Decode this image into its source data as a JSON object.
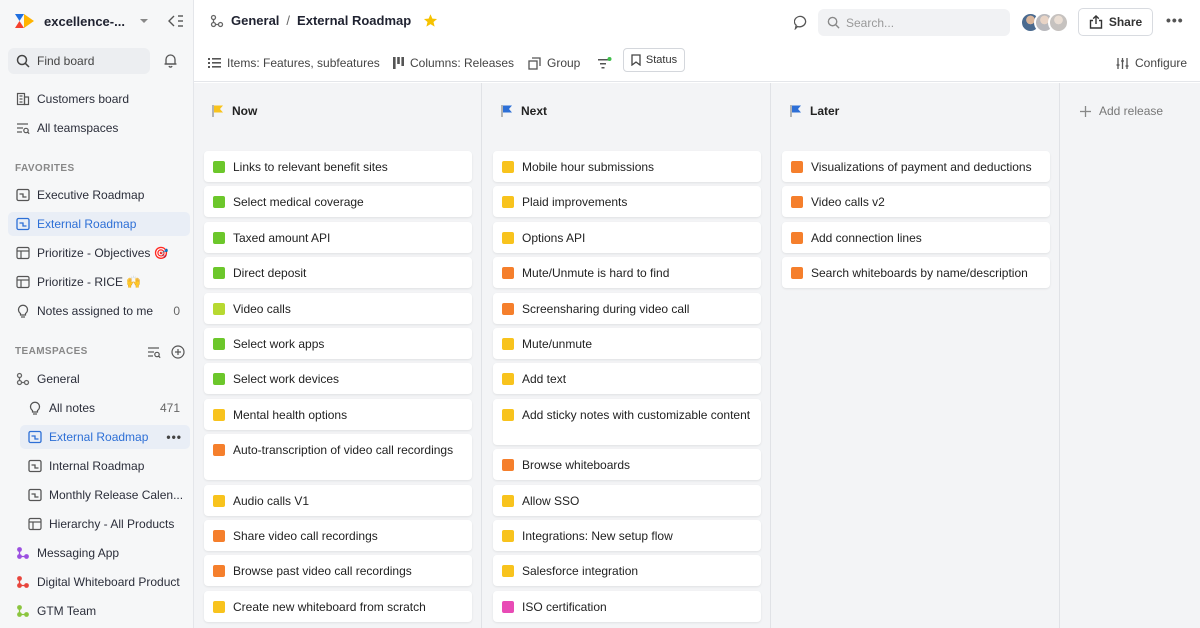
{
  "colors": {
    "green": "#6cc72b",
    "lime": "#b7d931",
    "yellow": "#f8c31d",
    "orange": "#f57f2c",
    "magenta": "#e84bb5",
    "accent": "#2d6fd6"
  },
  "sidebar": {
    "workspace_name": "excellence-...",
    "find_board": "Find board",
    "top_items": [
      {
        "label": "Customers board",
        "icon": "building-icon"
      },
      {
        "label": "All teamspaces",
        "icon": "teamspaces-list-icon"
      }
    ],
    "favorites_label": "FAVORITES",
    "favorites": [
      {
        "label": "Executive Roadmap",
        "icon": "roadmap-icon"
      },
      {
        "label": "External Roadmap",
        "icon": "roadmap-icon",
        "active": true
      },
      {
        "label": "Prioritize - Objectives 🎯",
        "icon": "table-icon"
      },
      {
        "label": "Prioritize - RICE 🙌",
        "icon": "table-icon"
      },
      {
        "label": "Notes assigned to me",
        "icon": "lightbulb-icon",
        "count": "0"
      }
    ],
    "teamspaces_label": "TEAMSPACES",
    "teamspaces": [
      {
        "label": "General",
        "icon": "teamspace-icon",
        "sub": false
      },
      {
        "label": "All notes",
        "icon": "lightbulb-icon",
        "sub": true,
        "count": "471"
      },
      {
        "label": "External Roadmap",
        "icon": "roadmap-icon",
        "sub": true,
        "active": true
      },
      {
        "label": "Internal Roadmap",
        "icon": "roadmap-icon",
        "sub": true
      },
      {
        "label": "Monthly Release Calen...",
        "icon": "roadmap-icon",
        "sub": true
      },
      {
        "label": "Hierarchy - All Products",
        "icon": "table-icon",
        "sub": true
      },
      {
        "label": "Messaging App",
        "icon": "teamspace-purple-icon",
        "sub": false
      },
      {
        "label": "Digital Whiteboard Product",
        "icon": "teamspace-red-icon",
        "sub": false
      },
      {
        "label": "GTM Team",
        "icon": "teamspace-green-icon",
        "sub": false
      }
    ]
  },
  "header": {
    "crumb_parent": "General",
    "crumb_sep": "/",
    "crumb_current": "External Roadmap",
    "search_placeholder": "Search...",
    "share_label": "Share"
  },
  "toolbar": {
    "items_label": "Items: Features, subfeatures",
    "columns_label": "Columns: Releases",
    "group_label": "Group",
    "status_label": "Status",
    "configure_label": "Configure"
  },
  "board": {
    "add_release": "Add release",
    "columns": [
      {
        "title": "Now",
        "flag_color": "#f8c31d",
        "cards": [
          {
            "label": "Links to relevant benefit sites",
            "color": "#6cc72b"
          },
          {
            "label": "Select medical coverage",
            "color": "#6cc72b"
          },
          {
            "label": "Taxed amount API",
            "color": "#6cc72b"
          },
          {
            "label": "Direct deposit",
            "color": "#6cc72b"
          },
          {
            "label": "Video calls",
            "color": "#b7d931"
          },
          {
            "label": "Select work apps",
            "color": "#6cc72b"
          },
          {
            "label": "Select work devices",
            "color": "#6cc72b"
          },
          {
            "label": "Mental health options",
            "color": "#f8c31d"
          },
          {
            "label": "Auto-transcription of video call recordings",
            "color": "#f57f2c",
            "tall": true
          },
          {
            "label": "Audio calls V1",
            "color": "#f8c31d"
          },
          {
            "label": "Share video call recordings",
            "color": "#f57f2c"
          },
          {
            "label": "Browse past video call recordings",
            "color": "#f57f2c"
          },
          {
            "label": "Create new whiteboard from scratch",
            "color": "#f8c31d"
          }
        ]
      },
      {
        "title": "Next",
        "flag_color": "#2d6fd6",
        "cards": [
          {
            "label": "Mobile hour submissions",
            "color": "#f8c31d"
          },
          {
            "label": "Plaid improvements",
            "color": "#f8c31d"
          },
          {
            "label": "Options API",
            "color": "#f8c31d"
          },
          {
            "label": "Mute/Unmute is hard to find",
            "color": "#f57f2c"
          },
          {
            "label": "Screensharing during video call",
            "color": "#f57f2c"
          },
          {
            "label": "Mute/unmute",
            "color": "#f8c31d"
          },
          {
            "label": "Add text",
            "color": "#f8c31d"
          },
          {
            "label": "Add sticky notes with customizable content",
            "color": "#f8c31d",
            "tall": true
          },
          {
            "label": "Browse whiteboards",
            "color": "#f57f2c"
          },
          {
            "label": "Allow SSO",
            "color": "#f8c31d"
          },
          {
            "label": "Integrations: New setup flow",
            "color": "#f8c31d"
          },
          {
            "label": "Salesforce integration",
            "color": "#f8c31d"
          },
          {
            "label": "ISO certification",
            "color": "#e84bb5"
          }
        ]
      },
      {
        "title": "Later",
        "flag_color": "#2d6fd6",
        "cards": [
          {
            "label": "Visualizations of payment and deductions",
            "color": "#f57f2c"
          },
          {
            "label": "Video calls v2",
            "color": "#f57f2c"
          },
          {
            "label": "Add connection lines",
            "color": "#f57f2c"
          },
          {
            "label": "Search whiteboards by name/description",
            "color": "#f57f2c"
          }
        ]
      }
    ]
  }
}
